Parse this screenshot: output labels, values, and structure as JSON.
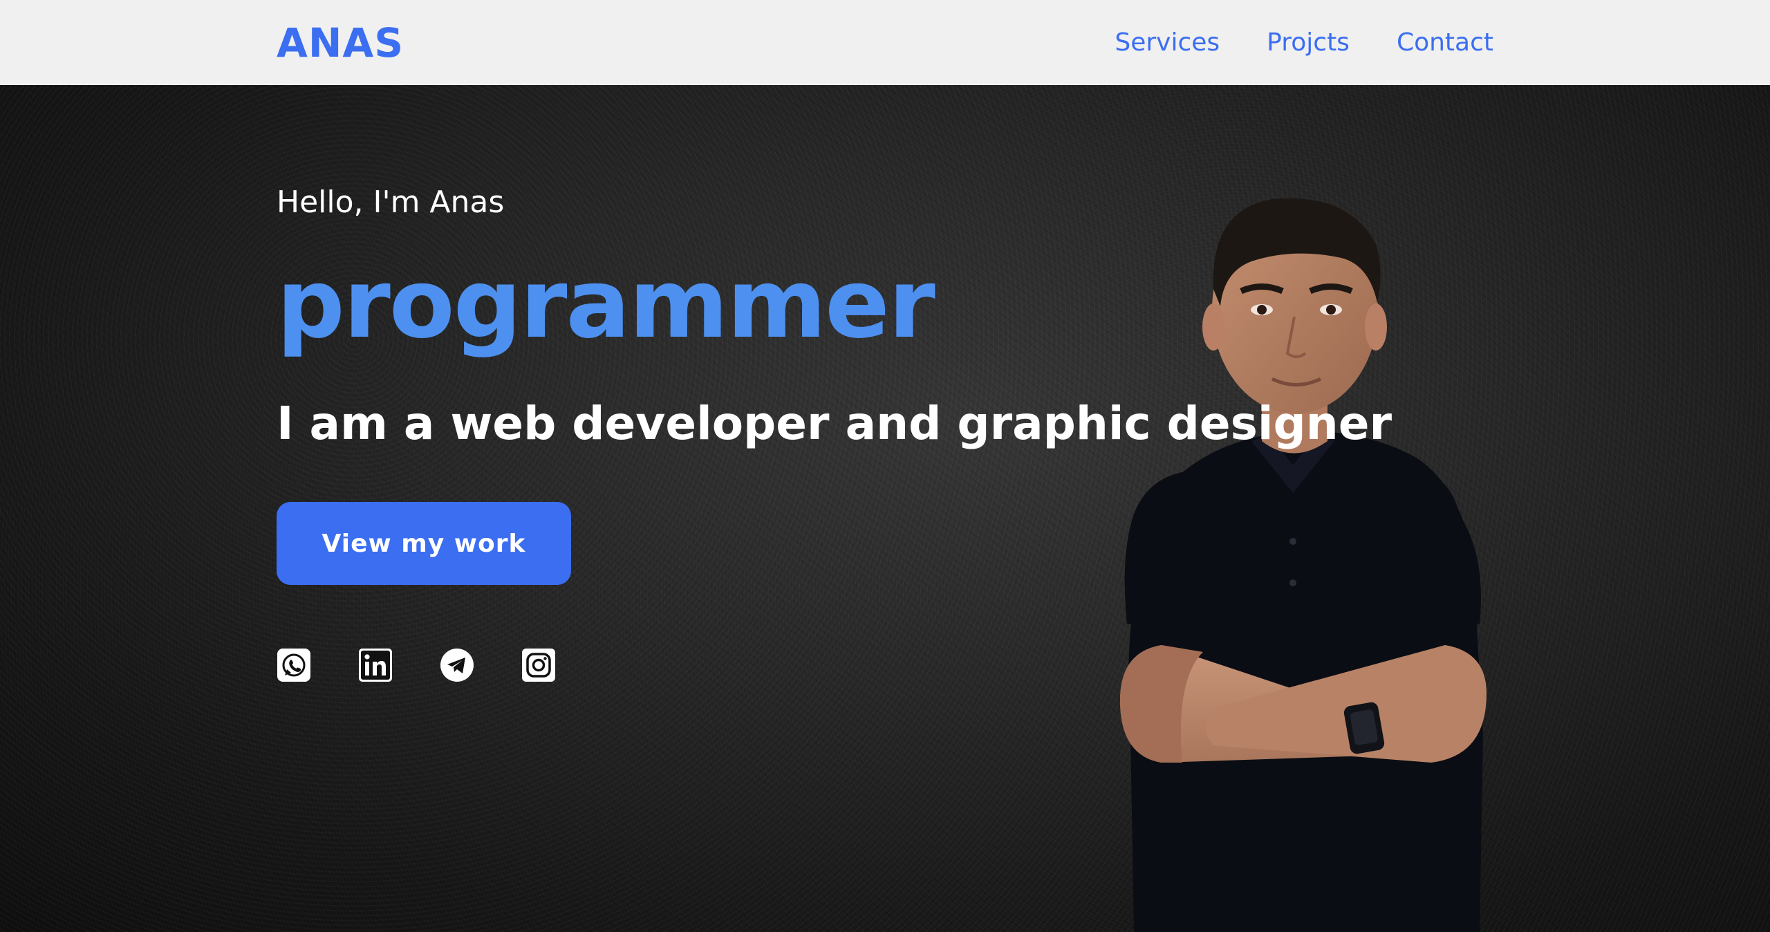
{
  "brand": {
    "logo": "ANAS",
    "accent_color": "#3b6ef0",
    "role_color": "#4d90f0"
  },
  "nav": {
    "items": [
      {
        "label": "Services"
      },
      {
        "label": "Projcts"
      },
      {
        "label": "Contact"
      }
    ]
  },
  "hero": {
    "greeting": "Hello, I'm Anas",
    "role": "programmer",
    "tagline": "I am a web developer and graphic designer",
    "cta_label": "View my work",
    "socials": [
      {
        "icon": "whatsapp-icon"
      },
      {
        "icon": "linkedin-icon"
      },
      {
        "icon": "telegram-icon"
      },
      {
        "icon": "instagram-icon"
      }
    ],
    "portrait": {
      "icon": "portrait-photo"
    }
  }
}
